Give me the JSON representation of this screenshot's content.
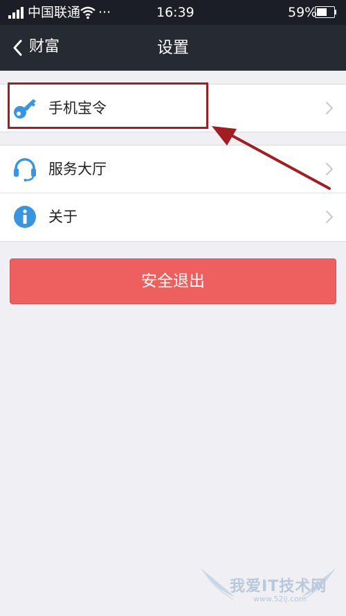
{
  "status_bar": {
    "carrier": "中国联通",
    "dots": "···",
    "time": "16:39",
    "battery_percent": "59%",
    "battery_level": 0.59,
    "signal_bars": 4
  },
  "nav": {
    "back_label": "财富",
    "title": "设置"
  },
  "settings": {
    "items": [
      {
        "label": "手机宝令",
        "icon": "key-icon"
      },
      {
        "label": "服务大厅",
        "icon": "headset-icon"
      },
      {
        "label": "关于",
        "icon": "info-icon"
      }
    ],
    "logout_label": "安全退出"
  },
  "annotation": {
    "highlight_color": "#a11d22",
    "arrow_color": "#a11d22"
  },
  "watermark": {
    "text": "我爱IT技术网",
    "url": "www.52ij.com"
  },
  "colors": {
    "status_bar_bg": "#1b1e26",
    "nav_bg": "#262a33",
    "page_bg": "#efeff4",
    "icon_blue": "#3a95e0",
    "logout_red": "#ee5f5f"
  }
}
